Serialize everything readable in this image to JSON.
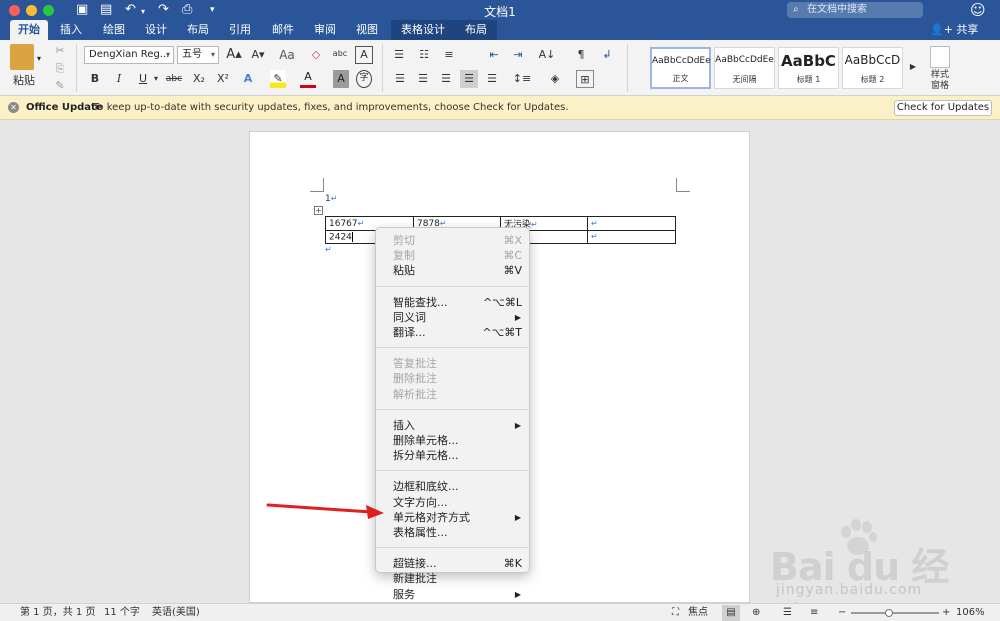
{
  "window": {
    "title": "文档1",
    "search_placeholder": "在文档中搜索"
  },
  "ribbon_tabs": {
    "items": [
      "开始",
      "插入",
      "绘图",
      "设计",
      "布局",
      "引用",
      "邮件",
      "审阅",
      "视图"
    ],
    "contextual": [
      "表格设计",
      "布局"
    ],
    "share": "共享"
  },
  "ribbon": {
    "paste_label": "粘贴",
    "font_name": "DengXian Reg...",
    "font_size": "五号",
    "bold": "B",
    "italic": "I",
    "underline": "U",
    "strike": "abc",
    "subscript": "X₂",
    "superscript": "X²",
    "grow": "A",
    "shrink": "A",
    "styles": [
      {
        "sample": "AaBbCcDdEe",
        "label": "正文"
      },
      {
        "sample": "AaBbCcDdEe",
        "label": "无间隔"
      },
      {
        "sample": "AaBbC",
        "label": "标题 1"
      },
      {
        "sample": "AaBbCcD",
        "label": "标题 2"
      }
    ],
    "styles_pane_label": "样式\n窗格"
  },
  "infobar": {
    "title": "Office Update",
    "message": "To keep up-to-date with security updates, fixes, and improvements, choose Check for Updates.",
    "button": "Check for Updates"
  },
  "document": {
    "first_line": "1",
    "table": [
      [
        "16767",
        "7878",
        "无污染",
        ""
      ],
      [
        "2424",
        "",
        "",
        ""
      ]
    ]
  },
  "context_menu": {
    "groups": [
      [
        {
          "label": "剪切",
          "shortcut": "⌘X",
          "disabled": true
        },
        {
          "label": "复制",
          "shortcut": "⌘C",
          "disabled": true
        },
        {
          "label": "粘贴",
          "shortcut": "⌘V",
          "disabled": false
        }
      ],
      [
        {
          "label": "智能查找...",
          "shortcut": "^⌥⌘L",
          "disabled": false
        },
        {
          "label": "同义词",
          "submenu": true,
          "disabled": false
        },
        {
          "label": "翻译...",
          "shortcut": "^⌥⌘T",
          "disabled": false
        }
      ],
      [
        {
          "label": "答复批注",
          "disabled": true
        },
        {
          "label": "删除批注",
          "disabled": true
        },
        {
          "label": "解析批注",
          "disabled": true
        }
      ],
      [
        {
          "label": "插入",
          "submenu": true,
          "disabled": false
        },
        {
          "label": "删除单元格...",
          "disabled": false
        },
        {
          "label": "拆分单元格...",
          "disabled": false
        }
      ],
      [
        {
          "label": "边框和底纹...",
          "disabled": false
        },
        {
          "label": "文字方向...",
          "disabled": false
        },
        {
          "label": "单元格对齐方式",
          "submenu": true,
          "disabled": false
        },
        {
          "label": "表格属性...",
          "disabled": false
        }
      ],
      [
        {
          "label": "超链接...",
          "shortcut": "⌘K",
          "disabled": false
        },
        {
          "label": "新建批注",
          "disabled": false
        },
        {
          "label": "服务",
          "submenu": true,
          "disabled": false
        }
      ]
    ]
  },
  "statusbar": {
    "page": "第 1 页，共 1 页",
    "words": "11 个字",
    "language": "英语(美国)",
    "focus": "焦点",
    "zoom": "106%"
  },
  "watermark": {
    "logo": "Bai du 经验",
    "url": "jingyan.baidu.com"
  },
  "colors": {
    "title_bar": "#2a5699",
    "infobar": "#fbf1c6",
    "annotation_arrow": "#e02020"
  }
}
